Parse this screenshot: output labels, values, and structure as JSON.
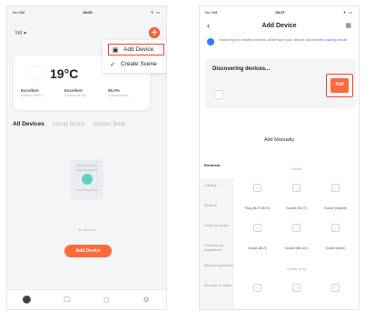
{
  "left_screen": {
    "status": {
      "carrier": "No SIM",
      "time": "08:53",
      "right": "✦ ▭"
    },
    "home_title": "Yet ▾",
    "plus_label": "+",
    "menu": {
      "add_device": "Add Device",
      "create_scene": "Create Scene"
    },
    "weather": {
      "temperature": "19°C",
      "stats": [
        {
          "value": "Excellent",
          "label": "Outdoor PM2.5"
        },
        {
          "value": "Excellent",
          "label": "Outdoor Air Qu..."
        },
        {
          "value": "95.0%",
          "label": "Outdoor Humi..."
        }
      ]
    },
    "rooms": [
      "All Devices",
      "Living Room",
      "Master Bedr"
    ],
    "rooms_more": "···",
    "empty_text": "No devices",
    "add_device_button": "Add Device",
    "tabbar_icons": [
      "home-icon",
      "scene-icon",
      "smart-icon",
      "me-icon"
    ]
  },
  "right_screen": {
    "status": {
      "carrier": "No SIM",
      "time": "08:37",
      "right": "✦ ▭"
    },
    "title": "Add Device",
    "notice_text": "Searching for nearby devices. Make sure your device has entered",
    "notice_link": "pairing mode.",
    "discovering": "Discovering devices...",
    "add_button": "Add",
    "add_manually": "Add Manually",
    "categories": [
      "Electrical",
      "Lighting",
      "Sensors",
      "Large Home Ap...",
      "Small Home Appliances",
      "Kitchen Appliances",
      "Exercise & Health"
    ],
    "grid": [
      {
        "label": "Socket"
      },
      {
        "devices": [
          "",
          "",
          ""
        ]
      },
      {
        "devices": [
          "Plug (BLE+Wi-Fi)",
          "Socket (Wi-Fi)",
          "Socket (Zigbee)"
        ]
      },
      {
        "devices": [
          "",
          "",
          ""
        ]
      },
      {
        "devices": [
          "Socket (BLE)",
          "Socket (NB-IoT)",
          "Socket (other)"
        ]
      },
      {
        "label": "Power Strip"
      },
      {
        "devices": [
          "",
          "",
          ""
        ]
      }
    ]
  }
}
